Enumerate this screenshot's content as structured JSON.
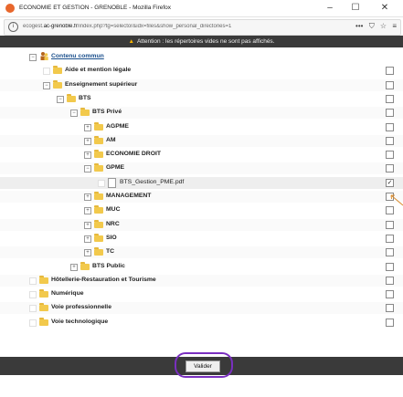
{
  "window": {
    "title": "ECONOMIE ET GESTION - GRENOBLE - Mozilla Firefox",
    "minimize": "–",
    "maximize": "☐",
    "close": "✕"
  },
  "urlbar": {
    "info": "i",
    "host_prefix": "ecogest.",
    "host": "ac-grenoble.fr",
    "path": "/index.php?tg=selector&idx=files&show_personal_directories=1",
    "icons": [
      "more-icon",
      "pocket-icon",
      "bookmark-star-icon",
      "menu-icon"
    ],
    "more": "•••",
    "pocket": "⛉",
    "star": "☆",
    "menu": "≡"
  },
  "warning": {
    "icon": "▲",
    "text": "Attention : les répertoires vides ne sont pas affichés."
  },
  "tree": {
    "root": "Contenu commun",
    "items": [
      {
        "label": "Aide et mention légale",
        "expander": "",
        "icon": "folder"
      },
      {
        "label": "Enseignement supérieur",
        "expander": "−",
        "icon": "folder"
      },
      {
        "label": "BTS",
        "expander": "−",
        "icon": "folder"
      },
      {
        "label": "BTS Privé",
        "expander": "−",
        "icon": "folder"
      },
      {
        "label": "AGPME",
        "expander": "+",
        "icon": "folder"
      },
      {
        "label": "AM",
        "expander": "+",
        "icon": "folder"
      },
      {
        "label": "ECONOMIE DROIT",
        "expander": "+",
        "icon": "folder"
      },
      {
        "label": "GPME",
        "expander": "−",
        "icon": "folder"
      },
      {
        "label": "BTS_Gestion_PME.pdf",
        "expander": "",
        "icon": "file"
      },
      {
        "label": "MANAGEMENT",
        "expander": "+",
        "icon": "folder"
      },
      {
        "label": "MUC",
        "expander": "+",
        "icon": "folder"
      },
      {
        "label": "NRC",
        "expander": "+",
        "icon": "folder"
      },
      {
        "label": "SIO",
        "expander": "+",
        "icon": "folder"
      },
      {
        "label": "TC",
        "expander": "+",
        "icon": "folder"
      },
      {
        "label": "BTS Public",
        "expander": "+",
        "icon": "folder"
      },
      {
        "label": "Hôtellerie-Restauration et Tourisme",
        "expander": "",
        "icon": "folder"
      },
      {
        "label": "Numérique",
        "expander": "",
        "icon": "folder"
      },
      {
        "label": "Voie professionnelle",
        "expander": "",
        "icon": "folder"
      },
      {
        "label": "Voie technologique",
        "expander": "",
        "icon": "folder"
      }
    ],
    "checked_mark": "✓"
  },
  "footer": {
    "submit_label": "Valider"
  },
  "colors": {
    "folder": "#f2c94c",
    "bar": "#3a3a3a",
    "highlight": "#7a2fc0",
    "warning_icon": "#f6b400",
    "link": "#1a4f8c"
  }
}
